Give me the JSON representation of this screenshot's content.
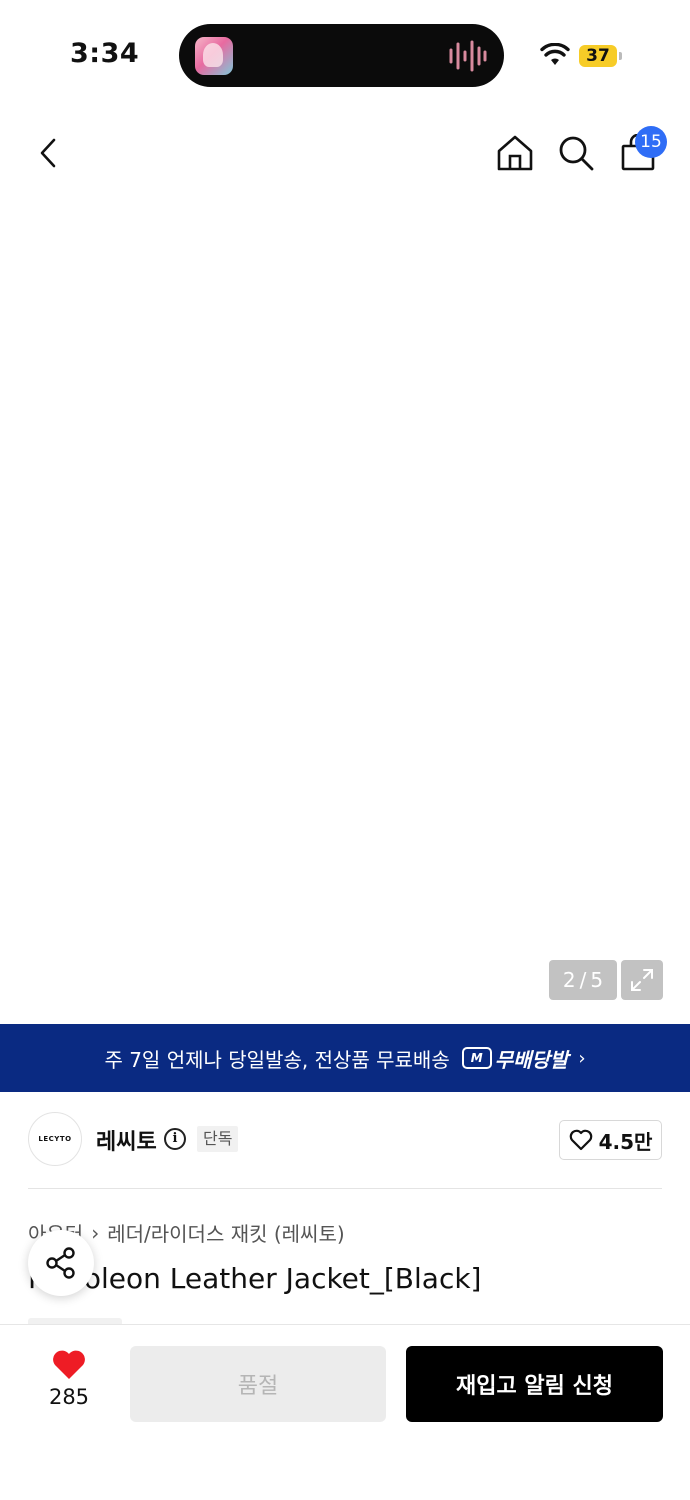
{
  "status_bar": {
    "time": "3:34",
    "battery": "37"
  },
  "header": {
    "cart_badge": "15"
  },
  "gallery": {
    "current": "2",
    "separator": "/",
    "total": "5"
  },
  "banner": {
    "text": "주 7일 언제나 당일발송, 전상품 무료배송",
    "logo_mark": "M",
    "logo_text": "무배당발",
    "chevron": "›"
  },
  "brand": {
    "logo_text": "LECYTO",
    "name": "레씨토",
    "info": "i",
    "exclusive": "단독",
    "likes": "4.5만"
  },
  "breadcrumb": {
    "category": "아우터",
    "separator": "›",
    "subcategory": "레더/라이더스 재킷 (레씨토)"
  },
  "product": {
    "title": "Napoleon Leather Jacket_[Black]"
  },
  "bottom_bar": {
    "like_count": "285",
    "soldout_label": "품절",
    "restock_label": "재입고 알림 신청"
  },
  "colors": {
    "banner_bg": "#0a2a82",
    "badge_blue": "#2f6df6",
    "heart_red": "#ee1c25",
    "battery_yellow": "#f7cc27"
  },
  "icons": [
    "chevron-left-icon",
    "home-icon",
    "search-icon",
    "shopping-bag-icon",
    "expand-icon",
    "delivery-truck-icon",
    "info-icon",
    "heart-outline-icon",
    "share-icon",
    "heart-filled-icon",
    "wifi-icon",
    "audio-wave-icon"
  ]
}
